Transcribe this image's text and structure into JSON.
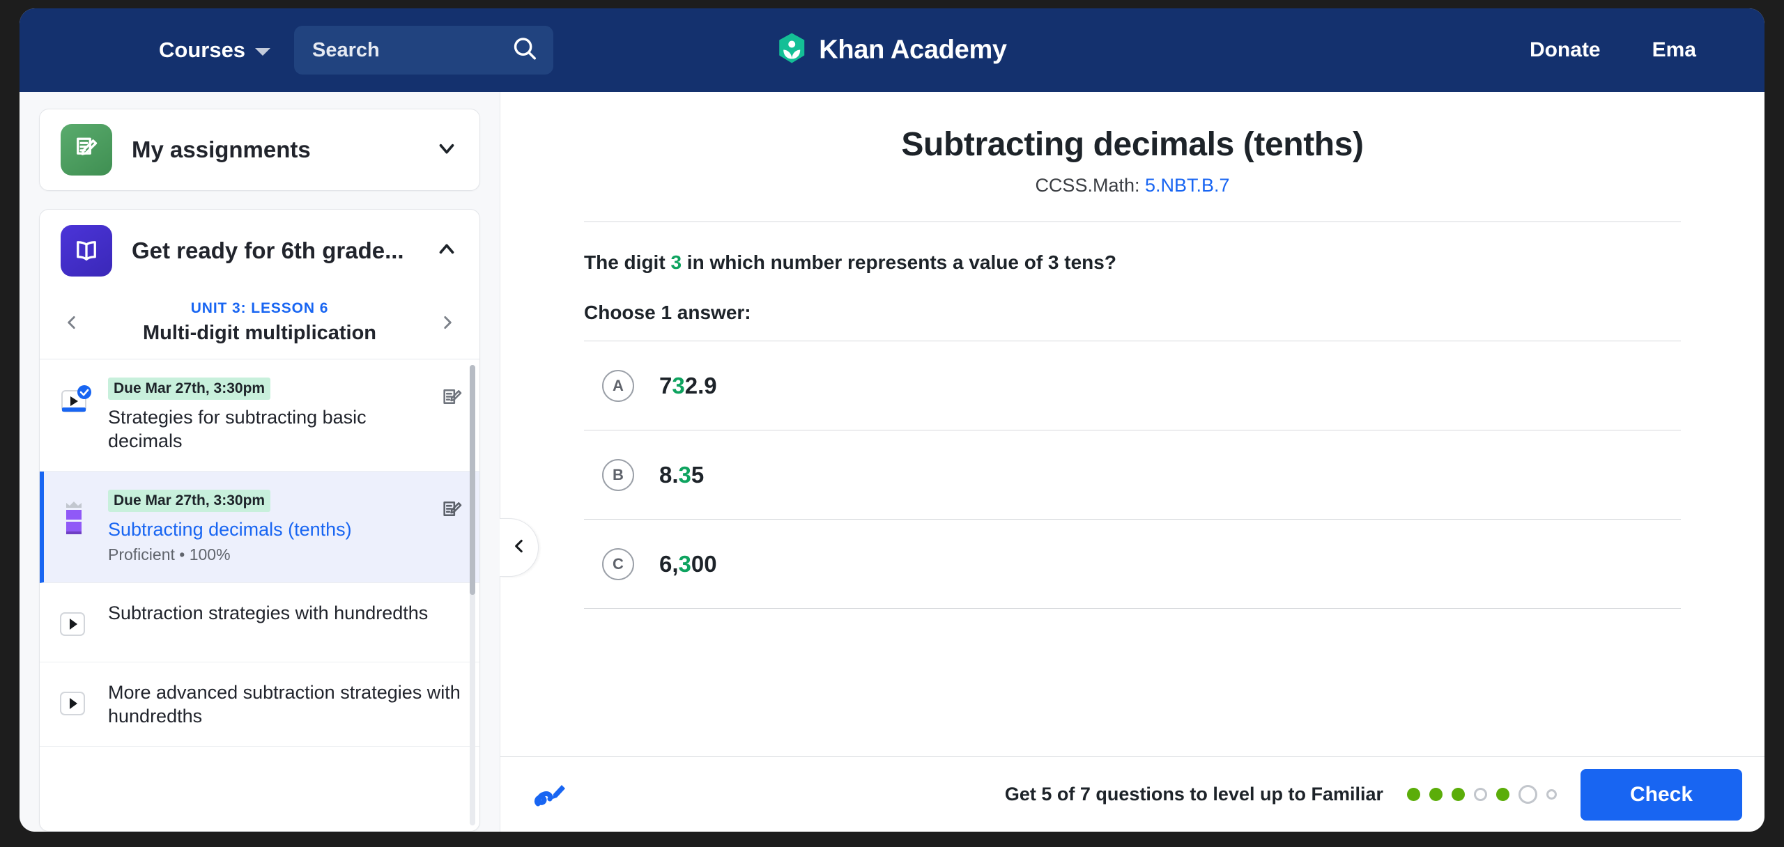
{
  "header": {
    "courses_label": "Courses",
    "search_placeholder": "Search",
    "brand_name": "Khan Academy",
    "donate_label": "Donate",
    "account_label": "Ema",
    "search_icon": "search-icon",
    "caret_icon": "chevron-down-icon",
    "logo_icon": "khan-academy-leaf-logo",
    "bg_color": "#14316e"
  },
  "sidebar": {
    "assignments": {
      "label": "My assignments",
      "icon": "assignment-clipboard-icon",
      "chevron": "chevron-down-icon"
    },
    "course": {
      "label": "Get ready for 6th grade...",
      "icon": "open-book-icon",
      "chevron": "chevron-up-icon"
    },
    "unit_nav": {
      "prev_icon": "chevron-left-icon",
      "next_icon": "chevron-right-icon",
      "unit_label": "UNIT 3: LESSON 6",
      "unit_title": "Multi-digit multiplication",
      "unit_label_color": "#1865f2"
    },
    "lessons": [
      {
        "due": "Due Mar 27th, 3:30pm",
        "title": "Strategies for subtracting basic decimals",
        "sub": "",
        "icon": "video-icon-completed",
        "right_icon": "assignment-icon",
        "active": false,
        "completed": true
      },
      {
        "due": "Due Mar 27th, 3:30pm",
        "title": "Subtracting decimals (tenths)",
        "sub": "Proficient • 100%",
        "icon": "mastery-bar-icon",
        "right_icon": "assignment-icon",
        "active": true,
        "completed": false
      },
      {
        "due": "",
        "title": "Subtraction strategies with hundredths",
        "sub": "",
        "icon": "video-icon",
        "right_icon": "",
        "active": false,
        "completed": false
      },
      {
        "due": "",
        "title": "More advanced subtraction strategies with hundredths",
        "sub": "",
        "icon": "video-icon",
        "right_icon": "",
        "active": false,
        "completed": false
      }
    ],
    "collapse_icon": "chevron-left-icon",
    "due_badge_color": "#c8f0dc",
    "active_accent_color": "#1865f2"
  },
  "exercise": {
    "title": "Subtracting decimals (tenths)",
    "standard_prefix": "CCSS.Math: ",
    "standard_code": "5.NBT.B.7",
    "question_pre": "The digit ",
    "question_highlight": "3",
    "question_post": " in which number represents a value of 3 tens?",
    "choose_label": "Choose 1 answer:",
    "highlight_color": "#0ea35f",
    "choices": [
      {
        "letter": "A",
        "pre": "7",
        "highlight": "3",
        "post": "2.9"
      },
      {
        "letter": "B",
        "pre": "8.",
        "highlight": "3",
        "post": "5"
      },
      {
        "letter": "C",
        "pre": "6,",
        "highlight": "3",
        "post": "00"
      }
    ]
  },
  "footer": {
    "scratchpad_icon": "scratchpad-pencil-icon",
    "level_text": "Get 5 of 7 questions to level up to Familiar",
    "dots": [
      "filled",
      "filled",
      "filled",
      "empty-sm",
      "filled",
      "empty-lg",
      "empty-xs"
    ],
    "check_label": "Check",
    "check_color": "#1865f2",
    "dot_filled_color": "#5bad09"
  }
}
